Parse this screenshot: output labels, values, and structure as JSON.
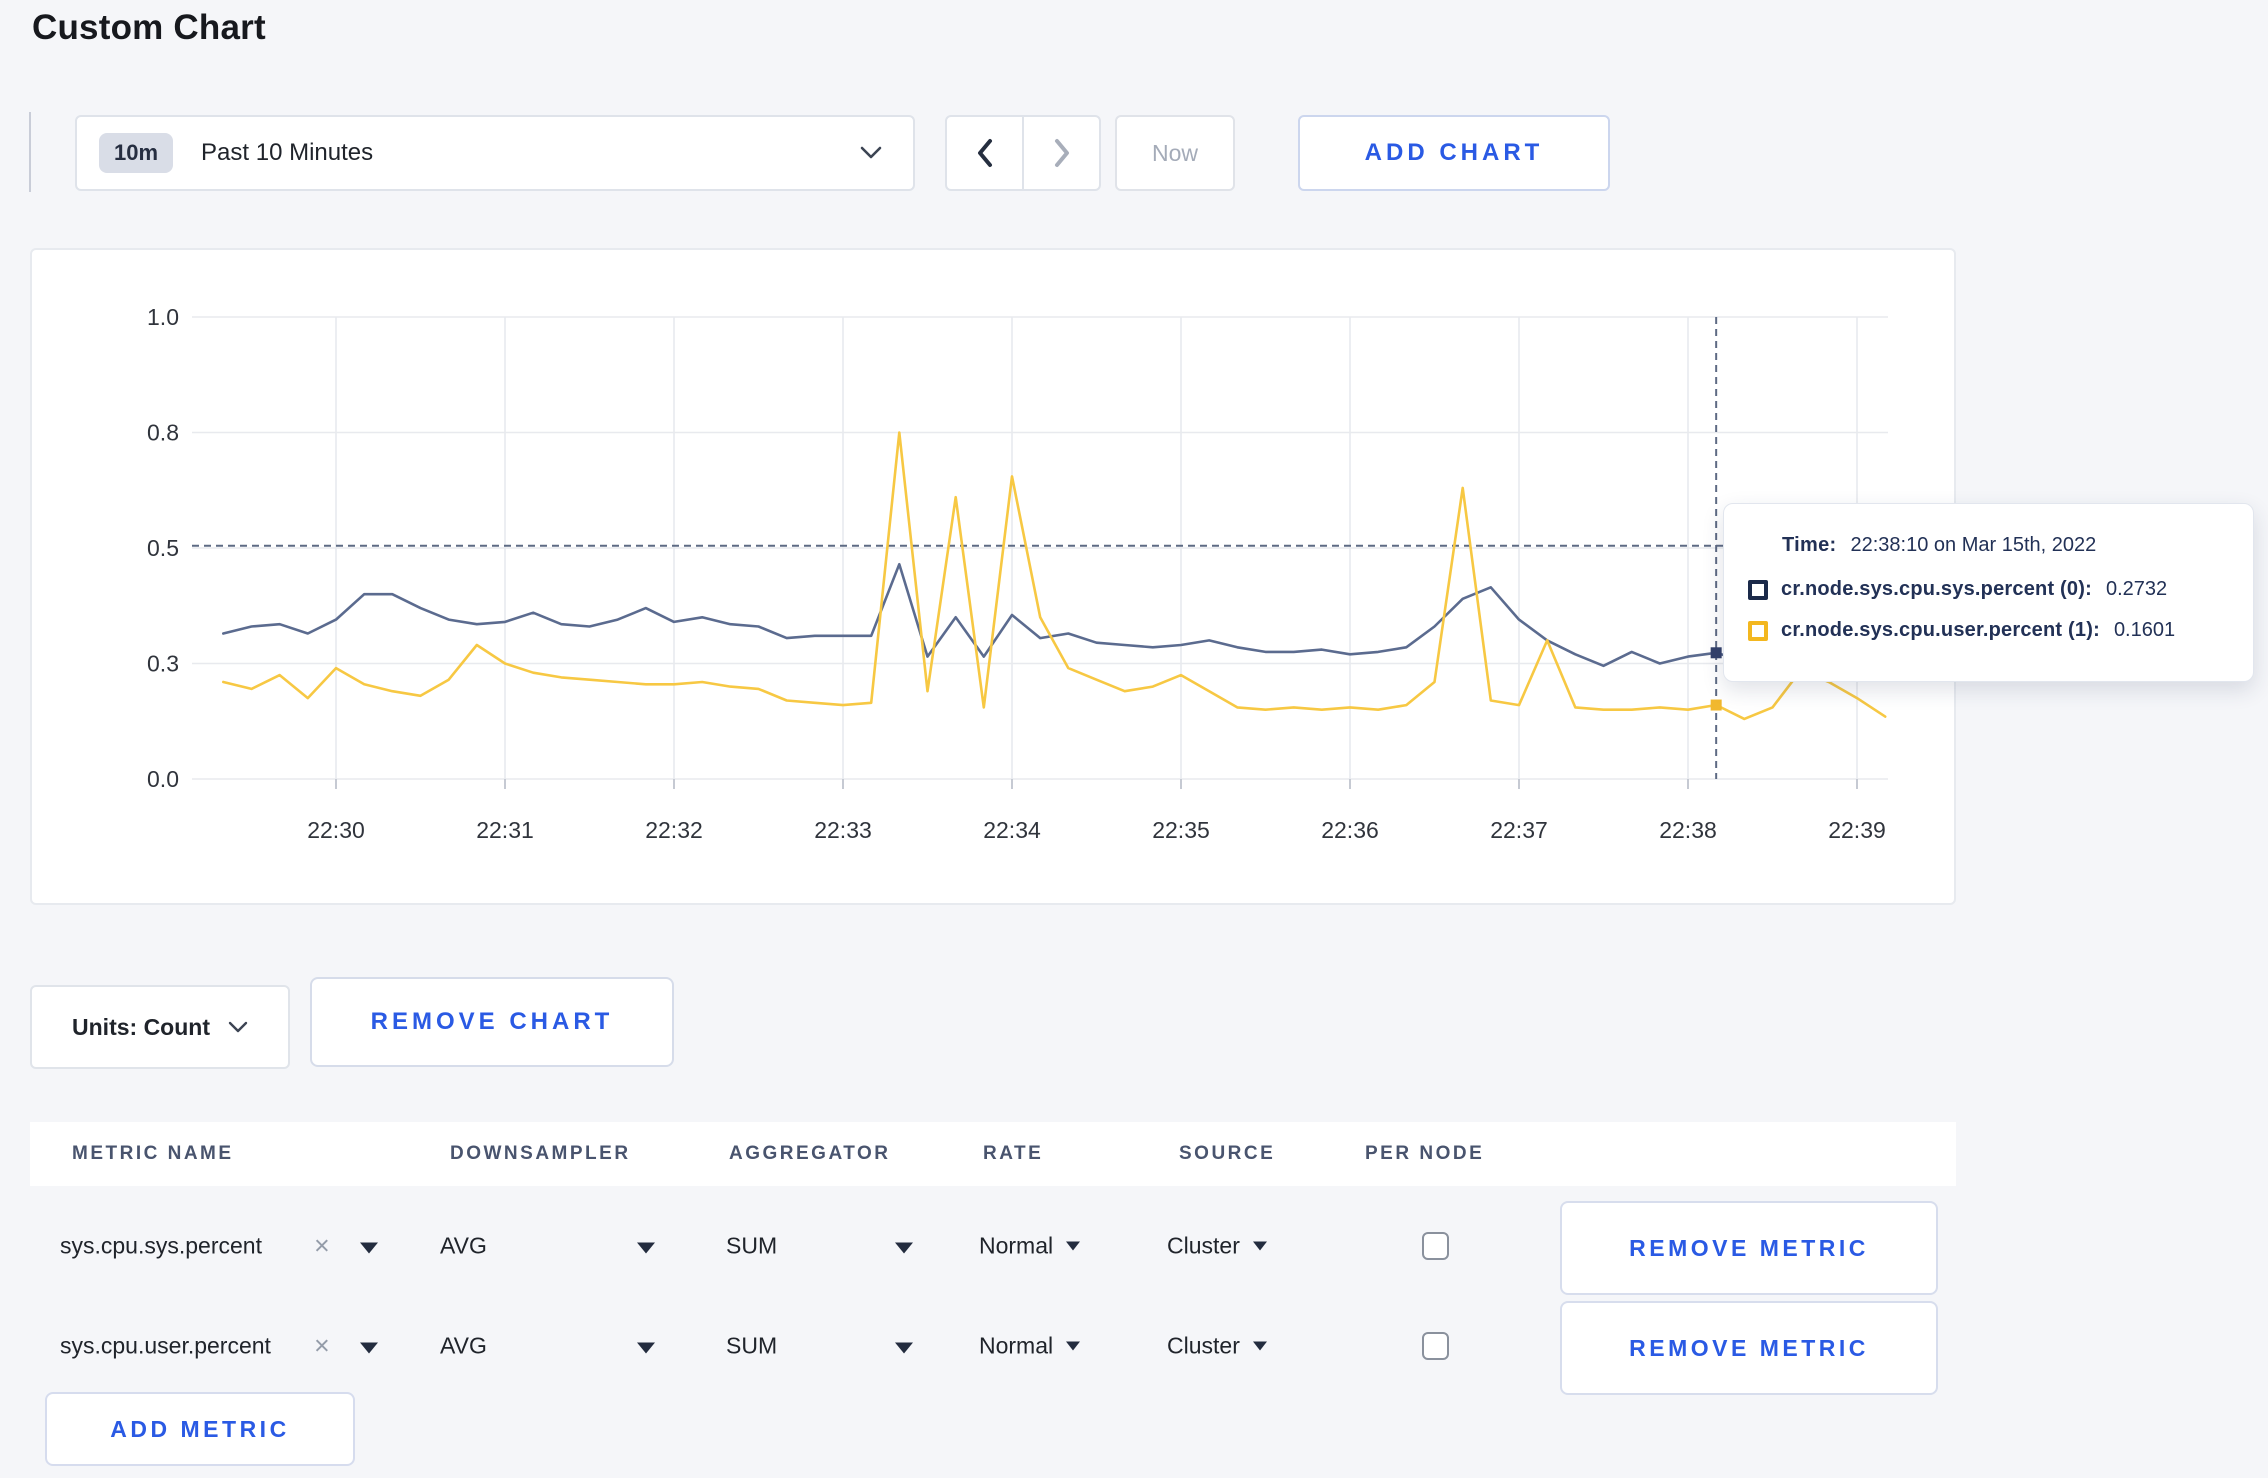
{
  "page": {
    "title": "Custom Chart"
  },
  "toolbar": {
    "time_range_badge": "10m",
    "time_range_label": "Past 10 Minutes",
    "now_label": "Now",
    "add_chart_label": "ADD CHART"
  },
  "icons": {
    "remove_tag_glyph": "×"
  },
  "chart": {
    "tooltip": {
      "time_label": "Time:",
      "time_value": "22:38:10 on Mar 15th, 2022",
      "series": [
        {
          "name": "cr.node.sys.cpu.sys.percent (0):",
          "value": "0.2732",
          "color": "#1b2a4a"
        },
        {
          "name": "cr.node.sys.cpu.user.percent (1):",
          "value": "0.1601",
          "color": "#f3b71f"
        }
      ]
    }
  },
  "chart_data": {
    "type": "line",
    "title": "",
    "x_axis": {
      "tick_labels": [
        "22:30",
        "22:31",
        "22:32",
        "22:33",
        "22:34",
        "22:35",
        "22:36",
        "22:37",
        "22:38",
        "22:39"
      ],
      "start_time": "22:29:20",
      "start_offset_seconds": -40,
      "sample_interval_seconds": 10
    },
    "y_axis": {
      "tick_labels": [
        "0.0",
        "0.3",
        "0.5",
        "0.8",
        "1.0"
      ],
      "tick_values": [
        0,
        0.25,
        0.5,
        0.75,
        1.0
      ],
      "range": [
        0,
        1
      ]
    },
    "grid": true,
    "legend_position": "tooltip",
    "series": [
      {
        "name": "cr.node.sys.cpu.sys.percent",
        "color": "#5b6b8f",
        "values": [
          0.315,
          0.33,
          0.335,
          0.315,
          0.345,
          0.4,
          0.4,
          0.37,
          0.345,
          0.335,
          0.34,
          0.36,
          0.335,
          0.33,
          0.345,
          0.37,
          0.34,
          0.35,
          0.335,
          0.33,
          0.305,
          0.31,
          0.31,
          0.31,
          0.465,
          0.265,
          0.35,
          0.265,
          0.355,
          0.305,
          0.315,
          0.295,
          0.29,
          0.285,
          0.29,
          0.3,
          0.285,
          0.275,
          0.275,
          0.28,
          0.27,
          0.275,
          0.285,
          0.33,
          0.39,
          0.415,
          0.345,
          0.3,
          0.27,
          0.245,
          0.275,
          0.25,
          0.265,
          0.2732,
          0.255,
          0.27,
          0.28,
          0.28,
          0.285,
          0.29
        ]
      },
      {
        "name": "cr.node.sys.cpu.user.percent",
        "color": "#f7c843",
        "values": [
          0.21,
          0.195,
          0.225,
          0.175,
          0.24,
          0.205,
          0.19,
          0.18,
          0.215,
          0.29,
          0.25,
          0.23,
          0.22,
          0.215,
          0.21,
          0.205,
          0.205,
          0.21,
          0.2,
          0.195,
          0.17,
          0.165,
          0.16,
          0.165,
          0.75,
          0.19,
          0.61,
          0.155,
          0.655,
          0.35,
          0.24,
          0.215,
          0.19,
          0.2,
          0.225,
          0.19,
          0.155,
          0.15,
          0.155,
          0.15,
          0.155,
          0.15,
          0.16,
          0.21,
          0.63,
          0.17,
          0.16,
          0.3,
          0.155,
          0.15,
          0.15,
          0.155,
          0.15,
          0.1601,
          0.13,
          0.155,
          0.235,
          0.21,
          0.175,
          0.135
        ]
      }
    ],
    "crosshair": {
      "time": "22:38:10",
      "time_offset_seconds": 490,
      "y_value": 0.505,
      "highlighted_points": [
        {
          "series": "cr.node.sys.cpu.sys.percent",
          "value": 0.2732,
          "marker_color": "#33416b"
        },
        {
          "series": "cr.node.sys.cpu.user.percent",
          "value": 0.1601,
          "marker_color": "#f1b82e"
        }
      ]
    }
  },
  "chart_controls": {
    "units_label": "Units: Count",
    "remove_chart_label": "REMOVE CHART"
  },
  "metrics_table": {
    "columns": [
      "METRIC NAME",
      "DOWNSAMPLER",
      "AGGREGATOR",
      "RATE",
      "SOURCE",
      "PER NODE"
    ],
    "rows": [
      {
        "name": "sys.cpu.sys.percent",
        "downsampler": "AVG",
        "aggregator": "SUM",
        "rate": "Normal",
        "source": "Cluster",
        "per_node_checked": false,
        "remove_label": "REMOVE METRIC"
      },
      {
        "name": "sys.cpu.user.percent",
        "downsampler": "AVG",
        "aggregator": "SUM",
        "rate": "Normal",
        "source": "Cluster",
        "per_node_checked": false,
        "remove_label": "REMOVE METRIC"
      }
    ],
    "add_metric_label": "ADD METRIC"
  }
}
